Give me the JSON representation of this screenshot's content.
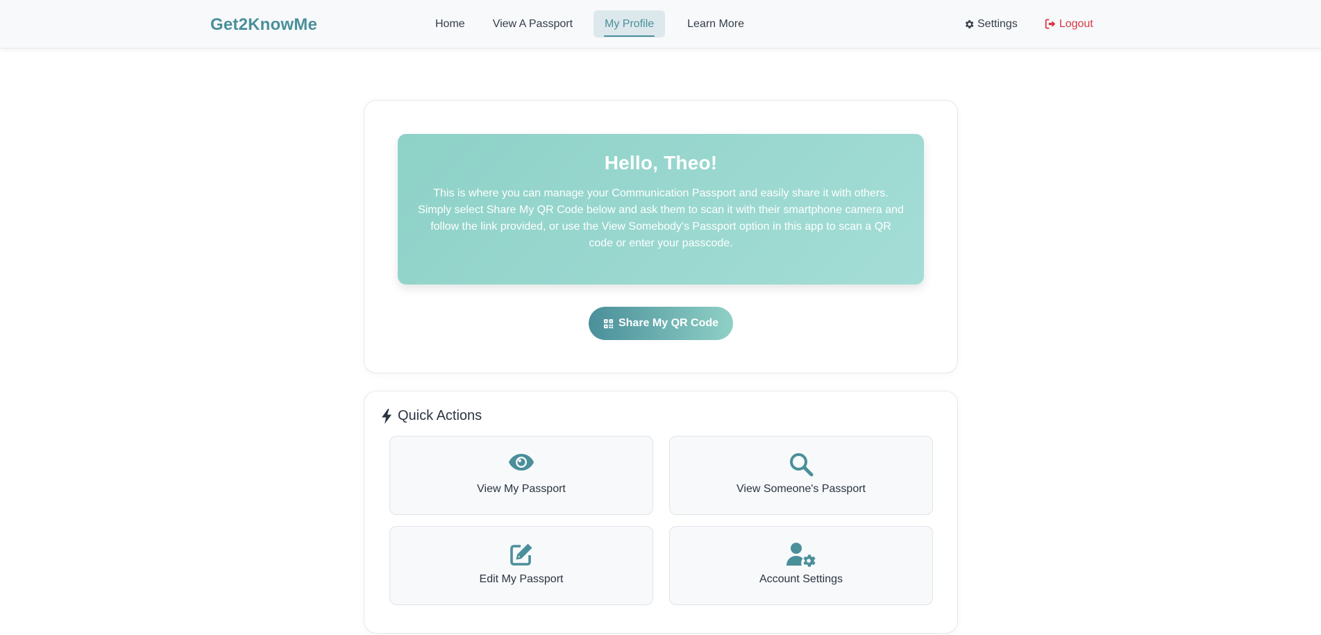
{
  "brand": "Get2KnowMe",
  "nav": {
    "links": [
      "Home",
      "View A Passport",
      "My Profile",
      "Learn More"
    ],
    "active": "My Profile",
    "settings_label": "Settings",
    "logout_label": "Logout"
  },
  "hero": {
    "greeting": "Hello, Theo!",
    "message": "This is where you can manage your Communication Passport and easily share it with others. Simply select Share My QR Code below and ask them to scan it with their smartphone camera and follow the link provided, or use the View Somebody's Passport option in this app to scan a QR code or enter your passcode.",
    "qr_button_label": "Share My QR Code"
  },
  "quick_actions": {
    "title": "Quick Actions",
    "items": [
      {
        "label": "View My Passport",
        "icon": "eye-icon"
      },
      {
        "label": "View Someone's Passport",
        "icon": "search-icon"
      },
      {
        "label": "Edit My Passport",
        "icon": "edit-icon"
      },
      {
        "label": "Account Settings",
        "icon": "user-gear-icon"
      }
    ]
  },
  "colors": {
    "brand": "#4a8f9a",
    "logout": "#d63845",
    "greeting_bg": "#8dd1c7"
  }
}
